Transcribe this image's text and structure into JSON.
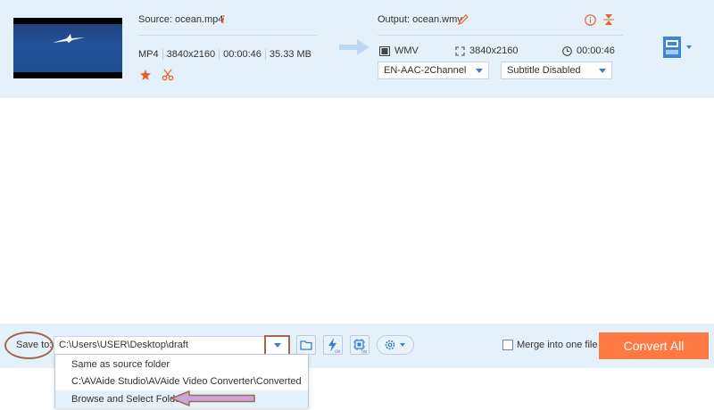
{
  "file": {
    "source_label": "Source: ocean.mp4",
    "format": "MP4",
    "resolution": "3840x2160",
    "duration": "00:00:46",
    "size": "35.33 MB",
    "output_label": "Output: ocean.wmv",
    "out_format": "WMV",
    "out_resolution": "3840x2160",
    "out_duration": "00:00:46",
    "audio_track": "EN-AAC-2Channel",
    "subtitle": "Subtitle Disabled"
  },
  "bottom": {
    "save_to": "Save to:",
    "path": "C:\\Users\\USER\\Desktop\\draft",
    "merge_label": "Merge into one file",
    "convert_label": "Convert All"
  },
  "dropdown": {
    "options": [
      "Same as source folder",
      "C:\\AVAide Studio\\AVAide Video Converter\\Converted",
      "Browse and Select Folder"
    ]
  },
  "colors": {
    "accent": "#ff7a42",
    "panel": "#e4f1fb",
    "annotation": "#a4684b"
  }
}
